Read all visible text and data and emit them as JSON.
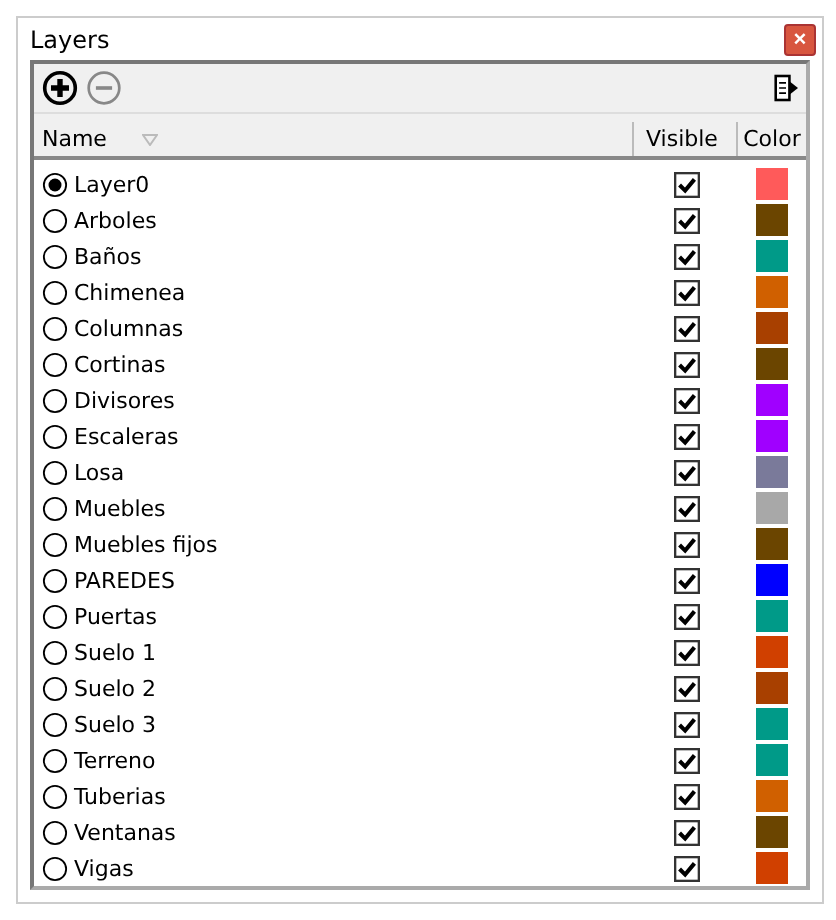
{
  "window": {
    "title": "Layers",
    "close": "×"
  },
  "columns": [
    "Name",
    "Visible",
    "Color"
  ],
  "layers": [
    {
      "name": "Layer0",
      "selected": true,
      "visible": true,
      "color": "#ff5a5a"
    },
    {
      "name": "Arboles",
      "selected": false,
      "visible": true,
      "color": "#6b4500"
    },
    {
      "name": "Baños",
      "selected": false,
      "visible": true,
      "color": "#009a88"
    },
    {
      "name": "Chimenea",
      "selected": false,
      "visible": true,
      "color": "#d06000"
    },
    {
      "name": "Columnas",
      "selected": false,
      "visible": true,
      "color": "#a84000"
    },
    {
      "name": "Cortinas",
      "selected": false,
      "visible": true,
      "color": "#6b4500"
    },
    {
      "name": "Divisores",
      "selected": false,
      "visible": true,
      "color": "#a000ff"
    },
    {
      "name": "Escaleras",
      "selected": false,
      "visible": true,
      "color": "#a000ff"
    },
    {
      "name": "Losa",
      "selected": false,
      "visible": true,
      "color": "#7a7a9a"
    },
    {
      "name": "Muebles",
      "selected": false,
      "visible": true,
      "color": "#a8a8a8"
    },
    {
      "name": "Muebles fijos",
      "selected": false,
      "visible": true,
      "color": "#6b4500"
    },
    {
      "name": "PAREDES",
      "selected": false,
      "visible": true,
      "color": "#0000ff"
    },
    {
      "name": "Puertas",
      "selected": false,
      "visible": true,
      "color": "#009a88"
    },
    {
      "name": "Suelo 1",
      "selected": false,
      "visible": true,
      "color": "#d04000"
    },
    {
      "name": "Suelo 2",
      "selected": false,
      "visible": true,
      "color": "#a84000"
    },
    {
      "name": "Suelo 3",
      "selected": false,
      "visible": true,
      "color": "#009a88"
    },
    {
      "name": "Terreno",
      "selected": false,
      "visible": true,
      "color": "#009a88"
    },
    {
      "name": "Tuberias",
      "selected": false,
      "visible": true,
      "color": "#d06000"
    },
    {
      "name": "Ventanas",
      "selected": false,
      "visible": true,
      "color": "#6b4500"
    },
    {
      "name": "Vigas",
      "selected": false,
      "visible": true,
      "color": "#d04000"
    }
  ]
}
